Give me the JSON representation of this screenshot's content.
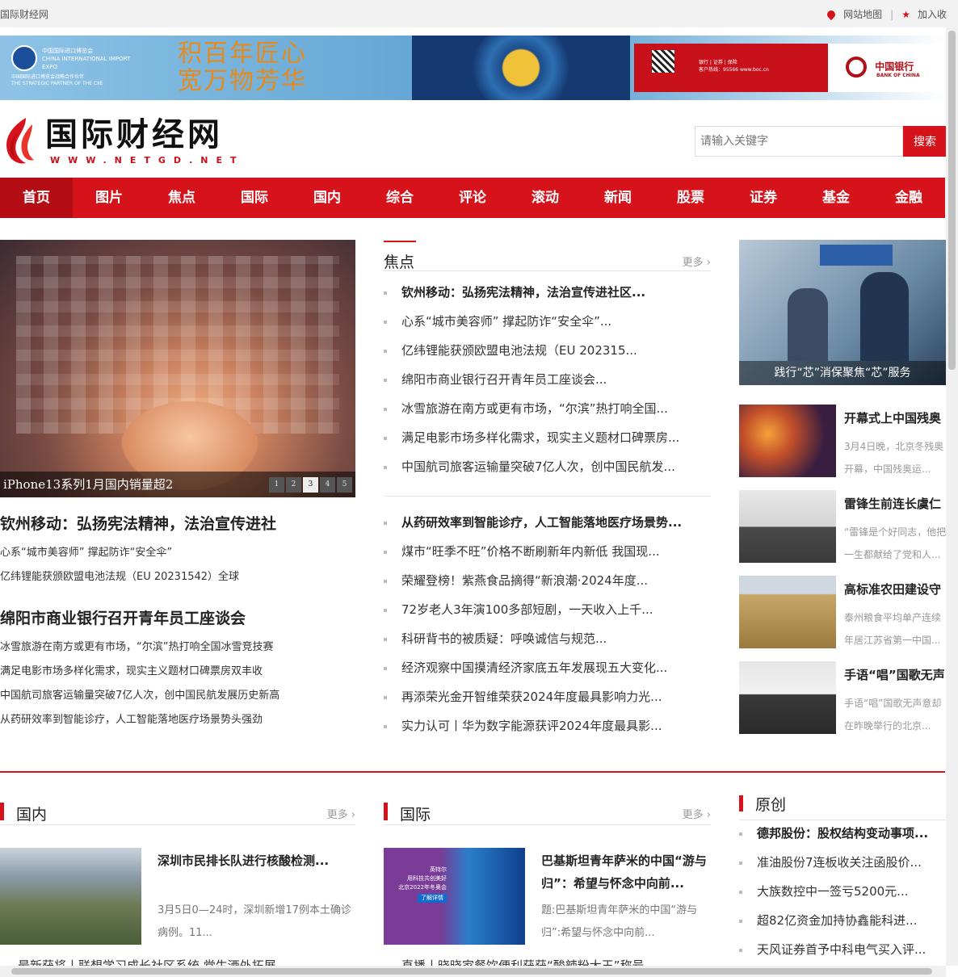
{
  "topbar": {
    "site_name": "国际财经网",
    "sitemap": "网站地图",
    "divider": "|",
    "favorite": "加入收"
  },
  "banner": {
    "expo_cn": "中国国际进口博览会",
    "expo_en": "CHINA INTERNATIONAL IMPORT EXPO",
    "expo_tag_cn": "中国国际进口博览会战略合作伙伴",
    "expo_tag_en": "THE STRATEGIC PARTNER OF THE CIIE",
    "slogan_line1": "积百年匠心",
    "slogan_line2": "宽万物芳华",
    "services": "银行 | 证券 | 保险",
    "hotline": "客户热线：95566  www.boc.cn",
    "bank_cn": "中国银行",
    "bank_en": "BANK OF CHINA"
  },
  "header": {
    "logo_text": "国际财经网",
    "logo_url": "WWW.NETGD.NET"
  },
  "search": {
    "placeholder": "请输入关键字",
    "button": "搜索"
  },
  "nav": [
    "首页",
    "图片",
    "焦点",
    "国际",
    "国内",
    "综合",
    "评论",
    "滚动",
    "新闻",
    "股票",
    "证券",
    "基金",
    "金融"
  ],
  "slider": {
    "caption": "iPhone13系列1月国内销量超2",
    "dots": [
      "1",
      "2",
      "3",
      "4",
      "5"
    ],
    "active": 2
  },
  "lead1": {
    "title": "钦州移动：弘扬宪法精神，法治宣传进社",
    "lines": [
      "心系“城市美容师” 撑起防诈“安全伞”",
      "亿纬锂能获颁欧盟电池法规（EU 20231542）全球"
    ]
  },
  "lead2": {
    "title": "绵阳市商业银行召开青年员工座谈会",
    "lines": [
      "冰雪旅游在南方或更有市场，“尔滨”热打响全国冰雪竞技赛",
      "满足电影市场多样化需求，现实主义题材口碑票房双丰收",
      "中国航司旅客运输量突破7亿人次，创中国民航发展历史新高",
      "从药研效率到智能诊疗，人工智能落地医疗场景势头强劲"
    ]
  },
  "focus": {
    "title": "焦点",
    "more": "更多 ›",
    "list1": [
      "钦州移动：弘扬宪法精神，法治宣传进社区...",
      "心系“城市美容师” 撑起防诈“安全伞”...",
      "亿纬锂能获颁欧盟电池法规（EU 202315...",
      "绵阳市商业银行召开青年员工座谈会...",
      "冰雪旅游在南方或更有市场，“尔滨”热打响全国...",
      "满足电影市场多样化需求，现实主义题材口碑票房...",
      "中国航司旅客运输量突破7亿人次，创中国民航发..."
    ],
    "list2": [
      "从药研效率到智能诊疗，人工智能落地医疗场景势...",
      "煤市“旺季不旺”价格不断刷新年内新低 我国现...",
      "荣耀登榜！紫燕食品摘得“新浪潮·2024年度...",
      "72岁老人3年演100多部短剧，一天收入上千...",
      "科研背书的被质疑：呼唤诚信与规范...",
      "经济观察中国摸清经济家底五年发展现五大变化...",
      "再添荣光金开智维荣获2024年度最具影响力光...",
      "实力认可丨华为数字能源获评2024年度最具影..."
    ]
  },
  "right": {
    "hero_caption": "践行“芯”消保聚焦“芯”服务",
    "cards": [
      {
        "title": "开幕式上中国残奥",
        "desc1": "3月4日晚，北京冬残奥",
        "desc2": "开幕，中国残奥运..."
      },
      {
        "title": "雷锋生前连长虞仁",
        "desc1": "“雷锋是个好同志，他把",
        "desc2": "一生都献给了党和人..."
      },
      {
        "title": "高标准农田建设守",
        "desc1": "泰州粮食平均单产连续",
        "desc2": "年居江苏省第一中国..."
      },
      {
        "title": "手语“唱”国歌无声",
        "desc1": "手语“唱”国歌无声意却",
        "desc2": "在昨晚举行的北京..."
      }
    ]
  },
  "domestic": {
    "title": "国内",
    "more": "更多 ›",
    "news_title": "深圳市民排长队进行核酸检测...",
    "news_desc": "3月5日0—24时，深圳新增17例本土确诊病例。11...",
    "next": "最新获将丨联想学习成长社区系统 党生酒外拓展"
  },
  "intl": {
    "title": "国际",
    "more": "更多 ›",
    "news_title": "巴基斯坦青年萨米的中国“游与归”：希望与怀念中向前...",
    "news_desc": "题:巴基斯坦青年萨米的中国“游与归”:希望与怀念中向前...",
    "pic_text1": "英特尔",
    "pic_text2": "用科技共创美好",
    "pic_text3": "北京2022年冬奥会",
    "pic_btn": "了解详情",
    "next": "直播丨晓晓家餐饮便利获获“酸辣粉大王”称号"
  },
  "original": {
    "title": "原创",
    "list": [
      "德邦股份：股权结构变动事项...",
      "准油股份7连板收关注函股价...",
      "大族数控中一签亏5200元...",
      "超82亿资金加持协鑫能科进...",
      "天风证券首予中科电气买入评..."
    ]
  }
}
